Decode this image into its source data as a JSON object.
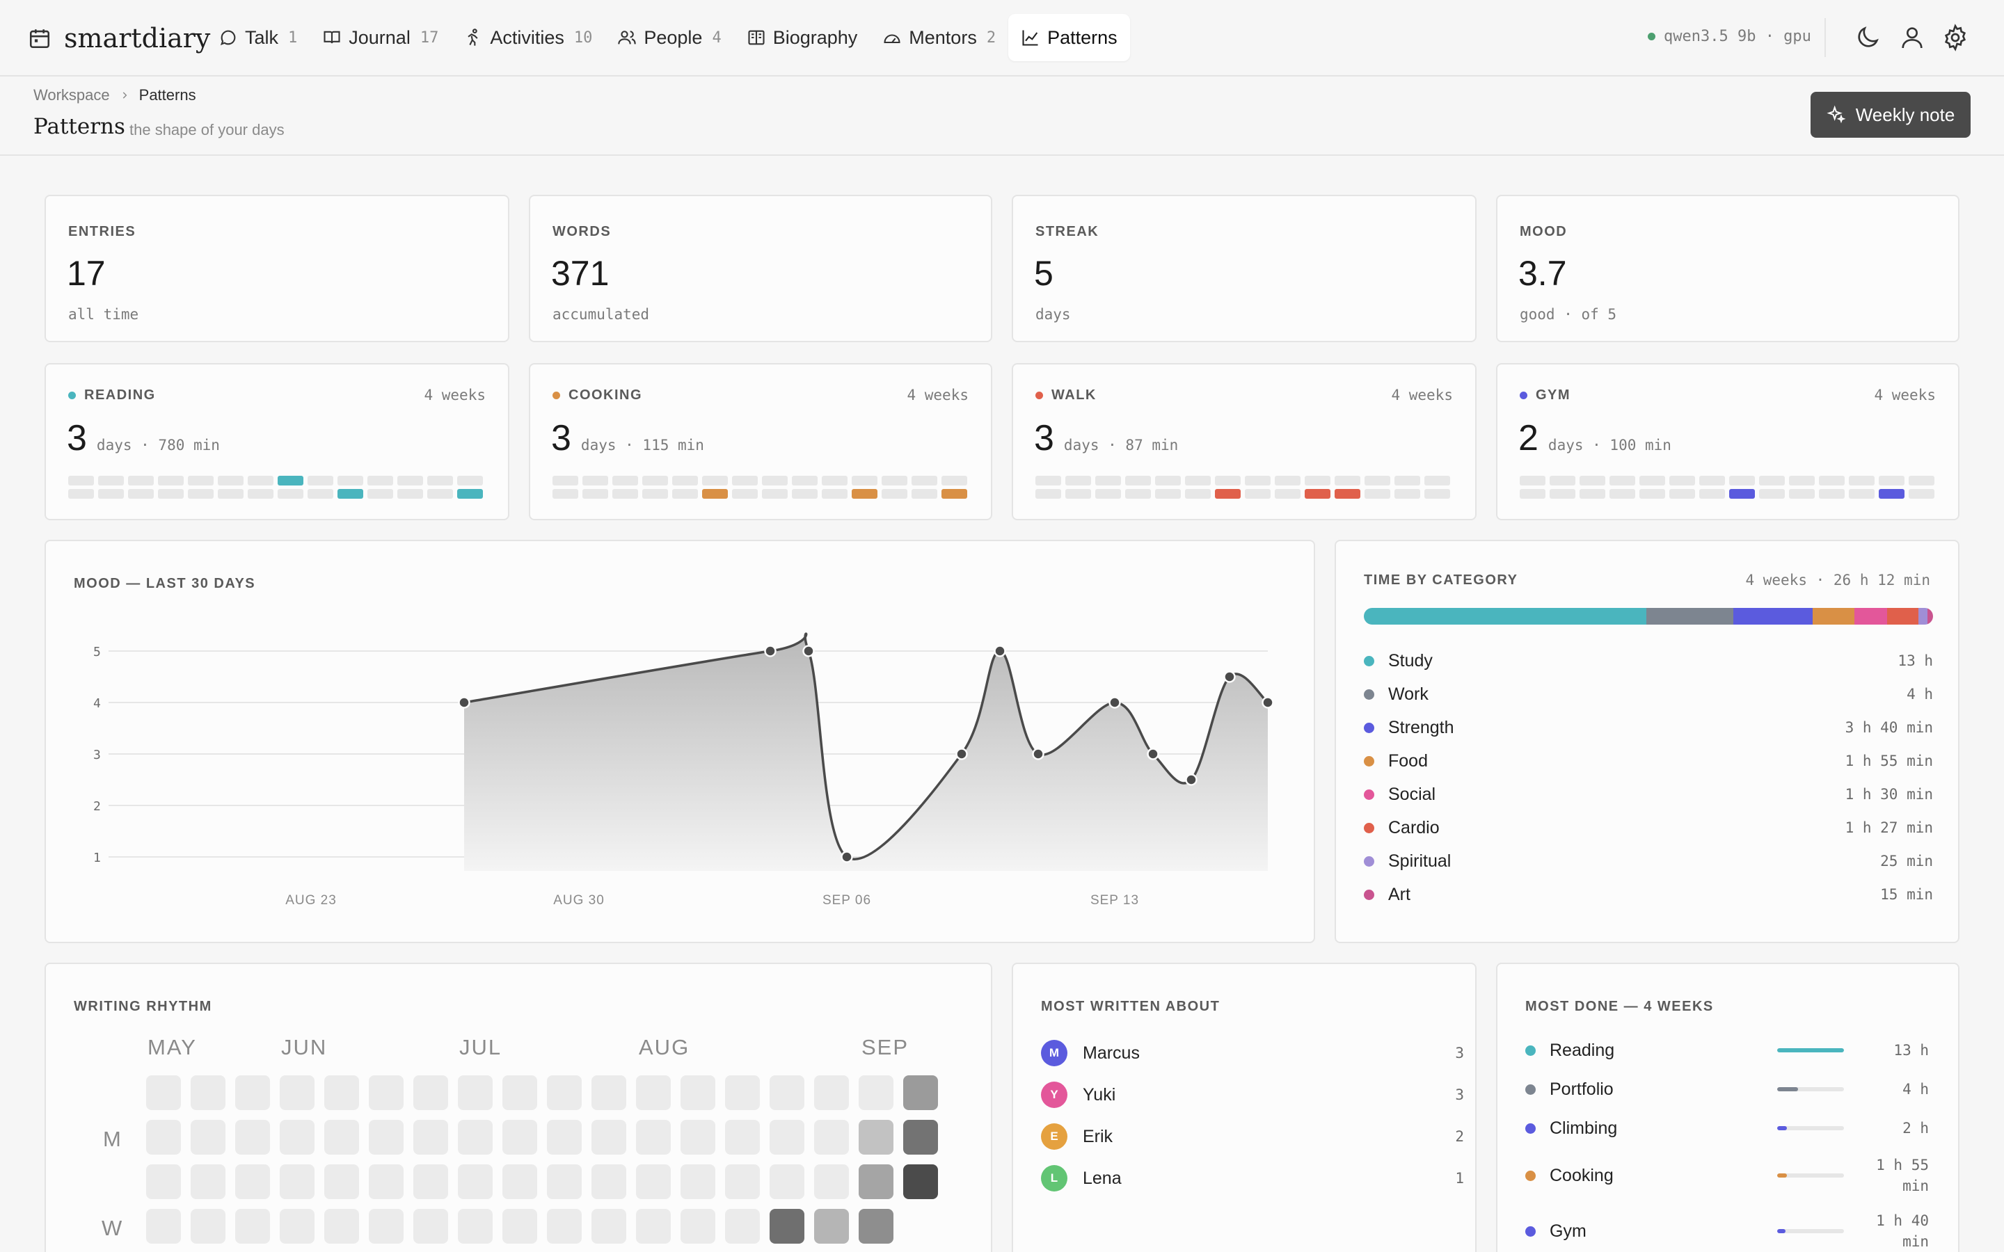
{
  "app": {
    "name": "smartdiary"
  },
  "nav": [
    {
      "label": "Talk",
      "count": "1",
      "icon": "chat-icon"
    },
    {
      "label": "Journal",
      "count": "17",
      "icon": "book-icon"
    },
    {
      "label": "Activities",
      "count": "10",
      "icon": "running-icon"
    },
    {
      "label": "People",
      "count": "4",
      "icon": "people-icon"
    },
    {
      "label": "Biography",
      "count": "",
      "icon": "open-book-icon"
    },
    {
      "label": "Mentors",
      "count": "2",
      "icon": "gauge-icon"
    },
    {
      "label": "Patterns",
      "count": "",
      "icon": "chart-line-icon",
      "active": true
    }
  ],
  "model": {
    "label": "qwen3.5 9b · gpu",
    "status_color": "#4c9f6f"
  },
  "breadcrumb": {
    "root": "Workspace",
    "current": "Patterns"
  },
  "page": {
    "title": "Patterns",
    "subtitle": "the shape of your days",
    "action": "Weekly note"
  },
  "stats": [
    {
      "label": "ENTRIES",
      "value": "17",
      "sub": "all time"
    },
    {
      "label": "WORDS",
      "value": "371",
      "sub": "accumulated"
    },
    {
      "label": "STREAK",
      "value": "5",
      "sub": "days"
    },
    {
      "label": "MOOD",
      "value": "3.7",
      "sub": "good · of 5"
    }
  ],
  "activities": [
    {
      "label": "READING",
      "weeks": "4 weeks",
      "value": "3",
      "detail": "days · 780 min",
      "color": "#4ab5be",
      "active_cells": [
        7,
        23,
        27
      ]
    },
    {
      "label": "COOKING",
      "weeks": "4 weeks",
      "value": "3",
      "detail": "days · 115 min",
      "color": "#d99045",
      "active_cells": [
        19,
        24,
        27
      ]
    },
    {
      "label": "WALK",
      "weeks": "4 weeks",
      "value": "3",
      "detail": "days · 87 min",
      "color": "#e0604b",
      "active_cells": [
        20,
        23,
        24
      ]
    },
    {
      "label": "GYM",
      "weeks": "4 weeks",
      "value": "2",
      "detail": "days · 100 min",
      "color": "#5b5bde",
      "active_cells": [
        21,
        26
      ]
    }
  ],
  "mood_chart": {
    "title": "MOOD — LAST 30 DAYS",
    "chart_data": {
      "type": "area",
      "x": [
        "Aug 27",
        "Sep 04",
        "Sep 05",
        "Sep 06",
        "Sep 09",
        "Sep 10",
        "Sep 11",
        "Sep 13",
        "Sep 14",
        "Sep 15",
        "Sep 16",
        "Sep 17"
      ],
      "y": [
        4,
        5,
        5,
        1,
        3,
        5,
        3,
        4,
        3,
        2.5,
        4.5,
        4
      ],
      "ylim": [
        1,
        5
      ],
      "yticks": [
        "1",
        "2",
        "3",
        "4",
        "5"
      ],
      "xtick_labels": [
        "AUG 23",
        "AUG 30",
        "SEP 06",
        "SEP 13"
      ],
      "grid": true
    }
  },
  "time_by_category": {
    "title": "TIME BY CATEGORY",
    "total": "4 weeks · 26 h 12 min",
    "items": [
      {
        "name": "Study",
        "time": "13 h",
        "minutes": 780,
        "color": "#4ab5be"
      },
      {
        "name": "Work",
        "time": "4 h",
        "minutes": 240,
        "color": "#7d8590"
      },
      {
        "name": "Strength",
        "time": "3 h 40 min",
        "minutes": 220,
        "color": "#5b5bde"
      },
      {
        "name": "Food",
        "time": "1 h 55 min",
        "minutes": 115,
        "color": "#d99045"
      },
      {
        "name": "Social",
        "time": "1 h 30 min",
        "minutes": 90,
        "color": "#e3579a"
      },
      {
        "name": "Cardio",
        "time": "1 h 27 min",
        "minutes": 87,
        "color": "#e0604b"
      },
      {
        "name": "Spiritual",
        "time": "25 min",
        "minutes": 25,
        "color": "#a08ed6"
      },
      {
        "name": "Art",
        "time": "15 min",
        "minutes": 15,
        "color": "#c9548f"
      }
    ]
  },
  "writing_rhythm": {
    "title": "WRITING RHYTHM",
    "months": [
      "MAY",
      "JUN",
      "JUL",
      "AUG",
      "SEP"
    ],
    "day_labels": [
      "M",
      "W"
    ],
    "filled": [
      {
        "row": 0,
        "col": 17,
        "shade": "#9b9b9b"
      },
      {
        "row": 1,
        "col": 16,
        "shade": "#c2c2c2"
      },
      {
        "row": 1,
        "col": 17,
        "shade": "#737373"
      },
      {
        "row": 2,
        "col": 16,
        "shade": "#a5a5a5"
      },
      {
        "row": 2,
        "col": 17,
        "shade": "#4b4b4b"
      },
      {
        "row": 3,
        "col": 14,
        "shade": "#6f6f6f"
      },
      {
        "row": 3,
        "col": 15,
        "shade": "#b5b5b5"
      },
      {
        "row": 3,
        "col": 16,
        "shade": "#8e8e8e"
      }
    ]
  },
  "people": {
    "title": "MOST WRITTEN ABOUT",
    "items": [
      {
        "initial": "M",
        "name": "Marcus",
        "count": "3",
        "color": "#5b5bde"
      },
      {
        "initial": "Y",
        "name": "Yuki",
        "count": "3",
        "color": "#e3579a"
      },
      {
        "initial": "E",
        "name": "Erik",
        "count": "2",
        "color": "#e5a13f"
      },
      {
        "initial": "L",
        "name": "Lena",
        "count": "1",
        "color": "#62c574"
      }
    ]
  },
  "most_done": {
    "title": "MOST DONE — 4 WEEKS",
    "items": [
      {
        "name": "Reading",
        "time": "13 h",
        "fraction": 1.0,
        "color": "#4ab5be"
      },
      {
        "name": "Portfolio",
        "time": "4 h",
        "fraction": 0.31,
        "color": "#7d8590"
      },
      {
        "name": "Climbing",
        "time": "2 h",
        "fraction": 0.15,
        "color": "#5b5bde"
      },
      {
        "name": "Cooking",
        "time": "1 h 55 min",
        "fraction": 0.15,
        "color": "#d99045"
      },
      {
        "name": "Gym",
        "time": "1 h 40 min",
        "fraction": 0.13,
        "color": "#5b5bde"
      }
    ]
  }
}
